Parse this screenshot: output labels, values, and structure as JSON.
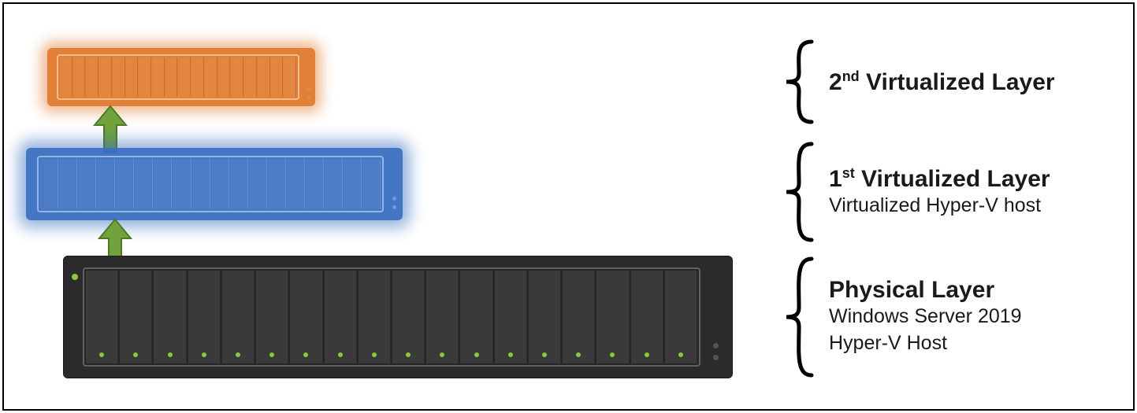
{
  "layers": {
    "l2": {
      "title_pre": "2",
      "title_sup": "nd",
      "title_post": " Virtualized Layer"
    },
    "l1": {
      "title_pre": "1",
      "title_sup": "st",
      "title_post": " Virtualized Layer",
      "sub": "Virtualized Hyper-V host"
    },
    "l0": {
      "title": "Physical Layer",
      "sub1": "Windows Server 2019",
      "sub2": "Hyper-V Host"
    }
  },
  "icons": {
    "arrow_up": "arrow-up-icon",
    "brace": "curly-brace-icon",
    "server": "server-rack-icon",
    "vm_blue": "virtual-server-icon",
    "vm_orange": "virtual-server-icon"
  },
  "colors": {
    "physical_bg": "#2b2b2b",
    "physical_led": "#8bc83f",
    "vm1": "#3a6fc0",
    "vm2": "#e07a2c",
    "arrow": "#70a33b"
  }
}
